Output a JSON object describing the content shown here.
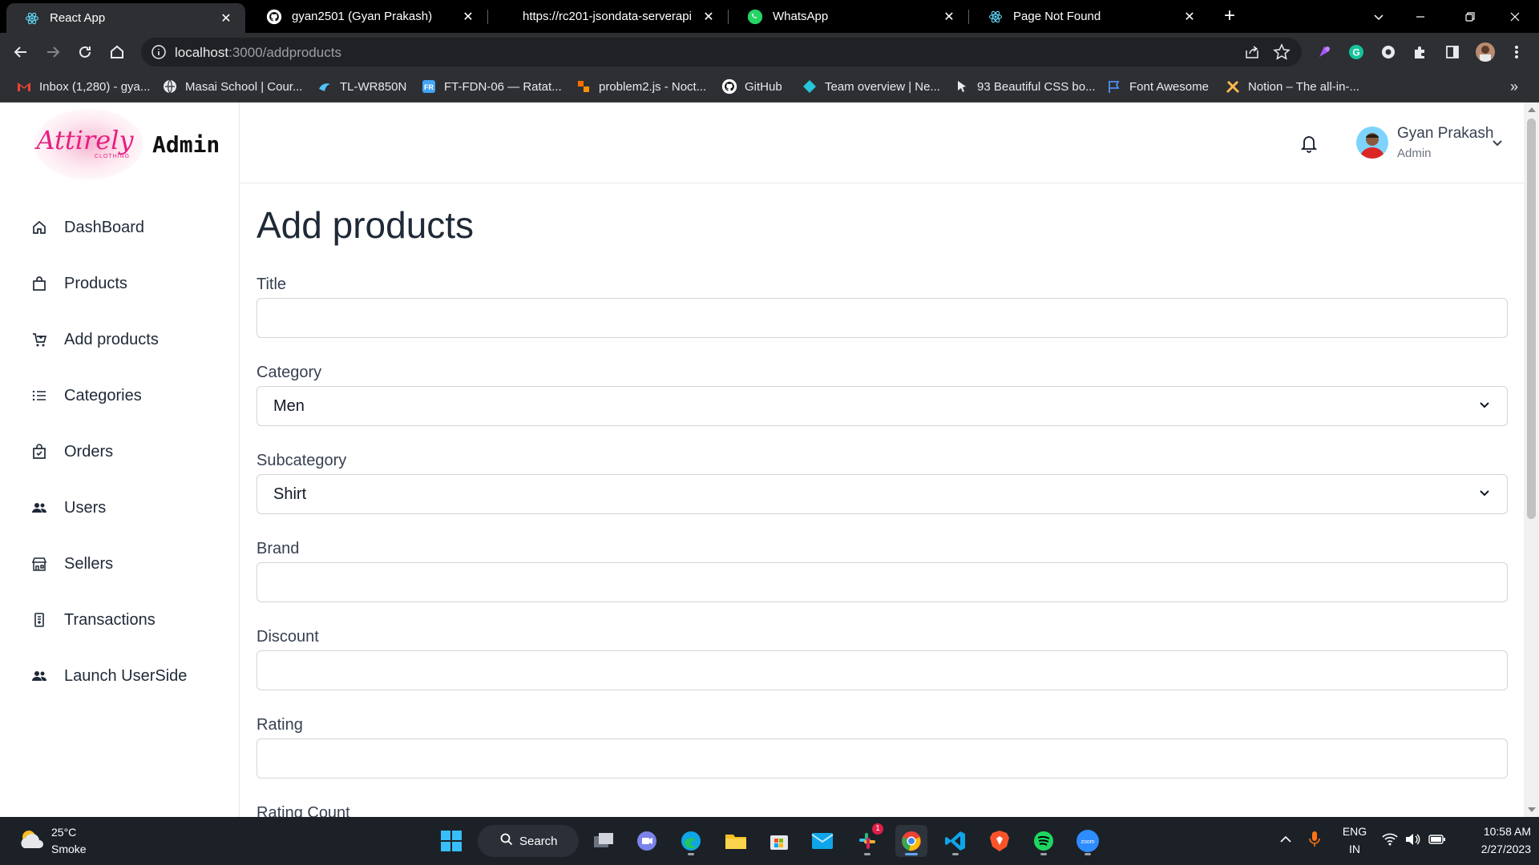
{
  "browser": {
    "tabs": [
      {
        "title": "React App",
        "icon": "react-icon"
      },
      {
        "title": "gyan2501 (Gyan Prakash)",
        "icon": "github-icon"
      },
      {
        "title": "https://rc201-jsondata-serverapi",
        "icon": "none"
      },
      {
        "title": "WhatsApp",
        "icon": "whatsapp-icon"
      },
      {
        "title": "Page Not Found",
        "icon": "react-icon"
      }
    ],
    "url_host": "localhost",
    "url_path": ":3000/addproducts",
    "bookmarks": [
      {
        "label": "Inbox (1,280) - gya...",
        "icon": "gmail-icon"
      },
      {
        "label": "Masai School | Cour...",
        "icon": "globe-icon"
      },
      {
        "label": "TL-WR850N",
        "icon": "router-icon"
      },
      {
        "label": "FT-FDN-06 — Ratat...",
        "icon": "fr-icon"
      },
      {
        "label": "problem2.js - Noct...",
        "icon": "noct-icon"
      },
      {
        "label": "GitHub",
        "icon": "github-icon"
      },
      {
        "label": "Team overview | Ne...",
        "icon": "netlify-icon"
      },
      {
        "label": "93 Beautiful CSS bo...",
        "icon": "cursor-icon"
      },
      {
        "label": "Font Awesome",
        "icon": "flag-icon"
      },
      {
        "label": "Notion – The all-in-...",
        "icon": "tools-icon"
      }
    ],
    "more_bookmarks": "»"
  },
  "sidebar": {
    "brand": "Admin",
    "logo_text": "Attirely",
    "logo_sub": "CLOTHING",
    "items": [
      {
        "label": "DashBoard",
        "icon": "home-icon"
      },
      {
        "label": "Products",
        "icon": "bag-icon"
      },
      {
        "label": "Add products",
        "icon": "cart-add-icon"
      },
      {
        "label": "Categories",
        "icon": "list-icon"
      },
      {
        "label": "Orders",
        "icon": "order-bag-icon"
      },
      {
        "label": "Users",
        "icon": "users-icon"
      },
      {
        "label": "Sellers",
        "icon": "store-icon"
      },
      {
        "label": "Transactions",
        "icon": "receipt-icon"
      },
      {
        "label": "Launch UserSide",
        "icon": "users-icon"
      }
    ]
  },
  "header": {
    "user_name": "Gyan Prakash",
    "user_role": "Admin"
  },
  "form": {
    "title": "Add products",
    "fields": {
      "title": {
        "label": "Title",
        "value": ""
      },
      "category": {
        "label": "Category",
        "value": "Men"
      },
      "subcategory": {
        "label": "Subcategory",
        "value": "Shirt"
      },
      "brand": {
        "label": "Brand",
        "value": ""
      },
      "discount": {
        "label": "Discount",
        "value": ""
      },
      "rating": {
        "label": "Rating",
        "value": ""
      },
      "rating_count": {
        "label": "Rating Count"
      }
    }
  },
  "taskbar": {
    "weather_temp": "25°C",
    "weather_desc": "Smoke",
    "search_label": "Search",
    "lang": "ENG",
    "region": "IN",
    "time": "10:58 AM",
    "date": "2/27/2023",
    "slack_badge": "1"
  },
  "colors": {
    "accent_blue": "#60a5fa",
    "chrome_dark": "#2d2f33",
    "taskbar": "#1c2128"
  }
}
